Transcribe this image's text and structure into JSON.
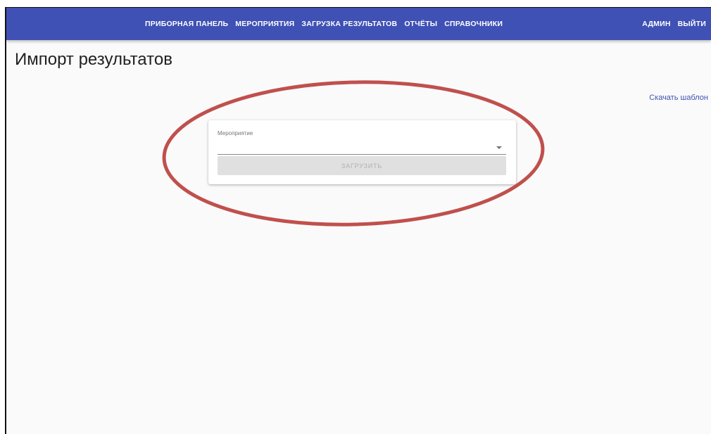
{
  "appbar": {
    "nav_items": [
      "ПРИБОРНАЯ ПАНЕЛЬ",
      "МЕРОПРИЯТИЯ",
      "ЗАГРУЗКА РЕЗУЛЬТАТОВ",
      "ОТЧЁТЫ",
      "СПРАВОЧНИКИ"
    ],
    "user_label": "АДМИН",
    "logout_label": "ВЫЙТИ",
    "color": "#3f51b5"
  },
  "page": {
    "title": "Импорт результатов",
    "download_template_label": "Скачать шаблон"
  },
  "form": {
    "event_label": "Мероприятие",
    "event_value": "",
    "upload_button_label": "ЗАГРУЗИТЬ",
    "upload_button_disabled": true
  },
  "annotation": {
    "shape": "ellipse",
    "color": "#c0504d"
  }
}
